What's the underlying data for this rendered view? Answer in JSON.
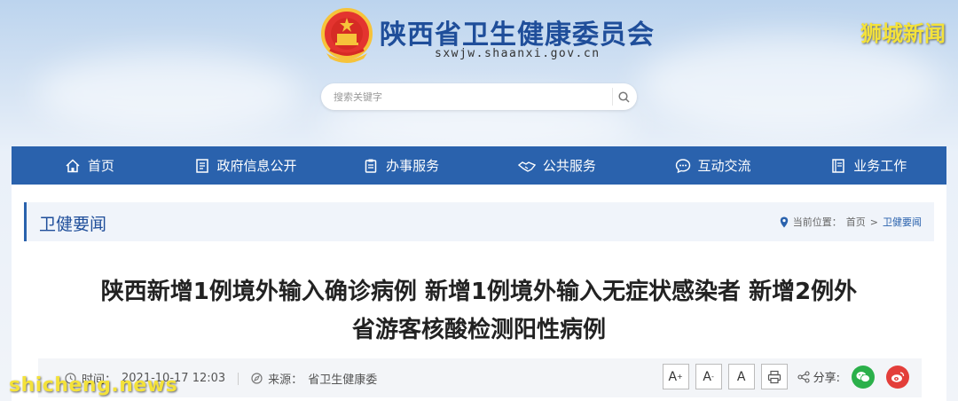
{
  "header": {
    "site_title": "陕西省卫生健康委员会",
    "site_url": "sxwjw.shaanxi.gov.cn",
    "watermark_top": "狮城新闻"
  },
  "search": {
    "placeholder": "搜索关键字",
    "icon": "search-icon"
  },
  "nav": {
    "items": [
      {
        "label": "首页",
        "icon": "home-icon"
      },
      {
        "label": "政府信息公开",
        "icon": "document-list-icon"
      },
      {
        "label": "办事服务",
        "icon": "clipboard-icon"
      },
      {
        "label": "公共服务",
        "icon": "handshake-icon"
      },
      {
        "label": "互动交流",
        "icon": "chat-icon"
      },
      {
        "label": "业务工作",
        "icon": "book-icon"
      }
    ],
    "color": "#2a62ad"
  },
  "section": {
    "title": "卫健要闻"
  },
  "breadcrumb": {
    "label": "当前位置：",
    "home": "首页",
    "separator": ">",
    "current": "卫健要闻"
  },
  "article": {
    "title_line1": "陕西新增1例境外输入确诊病例 新增1例境外输入无症状感染者 新增2例外",
    "title_line2": "省游客核酸检测阳性病例",
    "time_label": "时间：",
    "time_value": "2021-10-17 12:03",
    "source_label": "来源：",
    "source_value": "省卫生健康委"
  },
  "tools": {
    "font_large": "A",
    "font_large_sup": "+",
    "font_small": "A",
    "font_small_sup": "-",
    "font_reset": "A",
    "print_icon": "printer-icon",
    "share_label": "分享:",
    "share_icons": [
      "wechat-icon",
      "weibo-icon"
    ]
  },
  "watermark_bottom": "shicheng.news"
}
